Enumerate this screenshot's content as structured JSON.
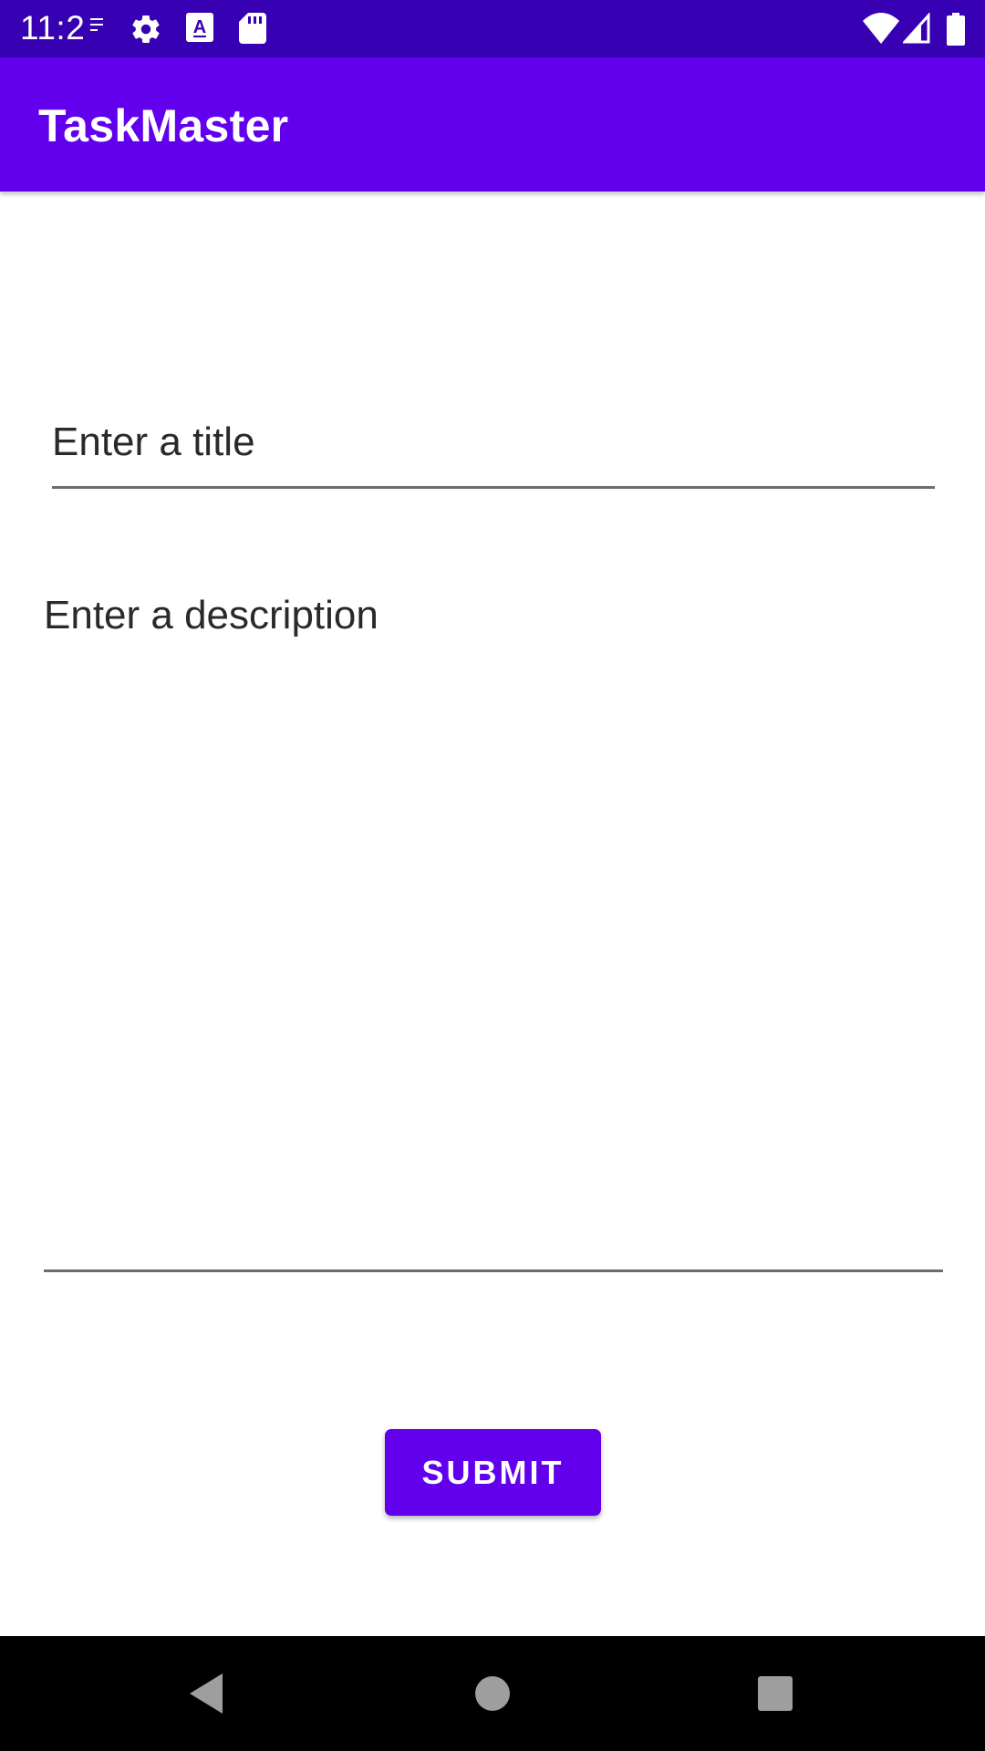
{
  "status_bar": {
    "time": "11:2",
    "icons": [
      "notification-dots-icon",
      "settings-gear-icon",
      "font-a-icon",
      "sd-card-icon",
      "wifi-icon",
      "cell-signal-icon",
      "battery-icon"
    ]
  },
  "app_bar": {
    "title": "TaskMaster"
  },
  "form": {
    "title_placeholder": "Enter a title",
    "description_placeholder": "Enter a description",
    "submit_label": "SUBMIT"
  },
  "nav_bar": {
    "icons": [
      "back-icon",
      "home-icon",
      "recents-icon"
    ]
  },
  "colors": {
    "status_bar": "#3700b3",
    "app_bar": "#6200ee",
    "button": "#6200ee",
    "nav_bar": "#000000"
  }
}
